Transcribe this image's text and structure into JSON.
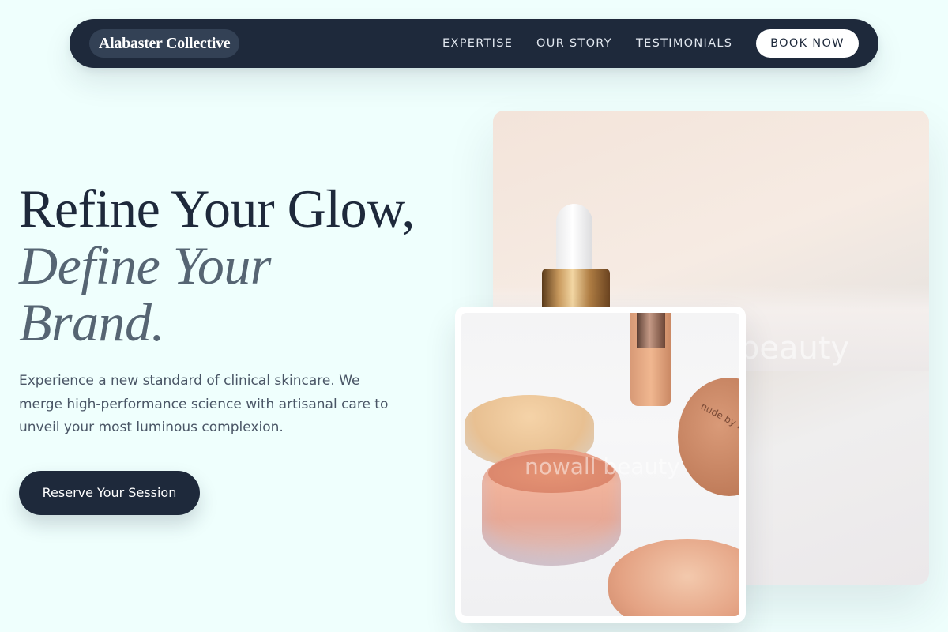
{
  "nav": {
    "brand": "Alabaster Collective",
    "links": [
      "EXPERTISE",
      "OUR STORY",
      "TESTIMONIALS"
    ],
    "cta_label": "BOOK NOW"
  },
  "hero": {
    "headline_line1": "Refine Your Glow,",
    "headline_line2": "Define Your",
    "headline_line3": "Brand.",
    "description": "Experience a new standard of clinical skincare. We merge high-performance science with artisanal care to unveil your most luminous complexion.",
    "cta_label": "Reserve Your Session"
  },
  "images": {
    "main_watermark": "beauty",
    "inset_watermark": "nowall beauty",
    "inset_lid_text": "nude by na"
  },
  "colors": {
    "background": "#effffd",
    "navy": "#1e293b",
    "slate_italic": "#566573"
  }
}
